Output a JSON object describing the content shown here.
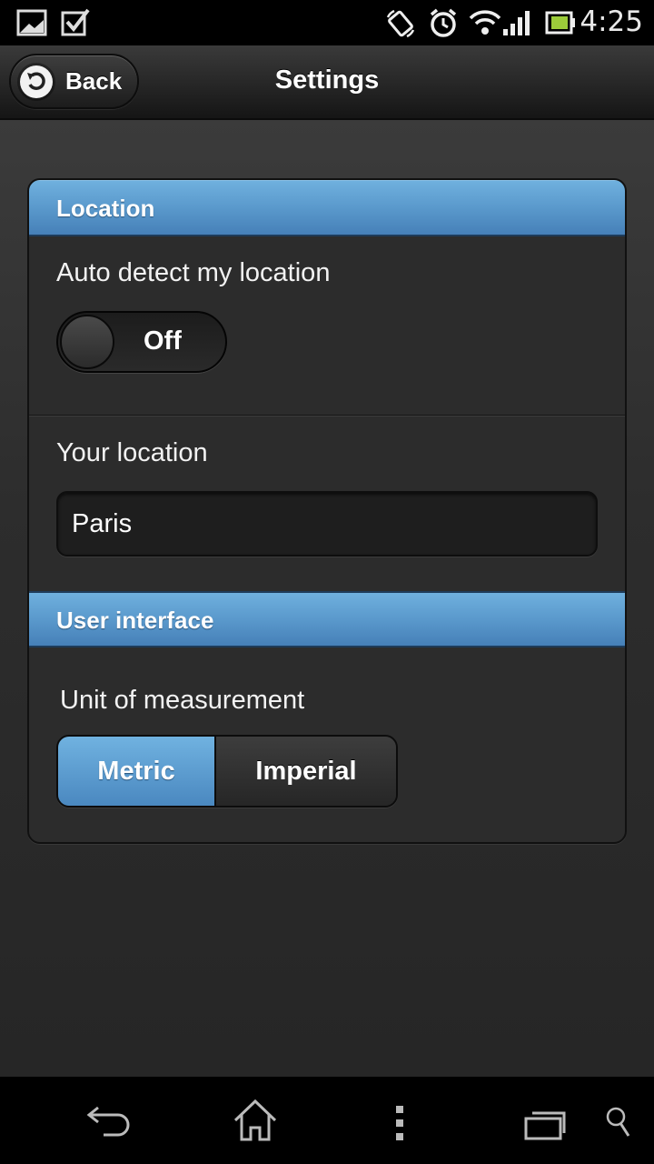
{
  "status_bar": {
    "time": "4:25",
    "icons": [
      "gallery-icon",
      "checkbox-icon",
      "rotate-icon",
      "alarm-icon",
      "wifi-icon",
      "signal-icon",
      "battery-icon"
    ]
  },
  "header": {
    "back_label": "Back",
    "title": "Settings"
  },
  "sections": {
    "location": {
      "title": "Location",
      "auto_detect_label": "Auto detect my location",
      "toggle_state": "Off",
      "your_location_label": "Your location",
      "your_location_value": "Paris"
    },
    "user_interface": {
      "title": "User interface",
      "unit_label": "Unit of measurement",
      "options": [
        "Metric",
        "Imperial"
      ],
      "selected": "Metric"
    }
  },
  "nav_bar": {
    "icons": [
      "back-icon",
      "home-icon",
      "menu-icon",
      "recent-apps-icon",
      "search-icon"
    ]
  },
  "colors": {
    "accent": "#5a99cc",
    "background": "#2a2a2a"
  }
}
